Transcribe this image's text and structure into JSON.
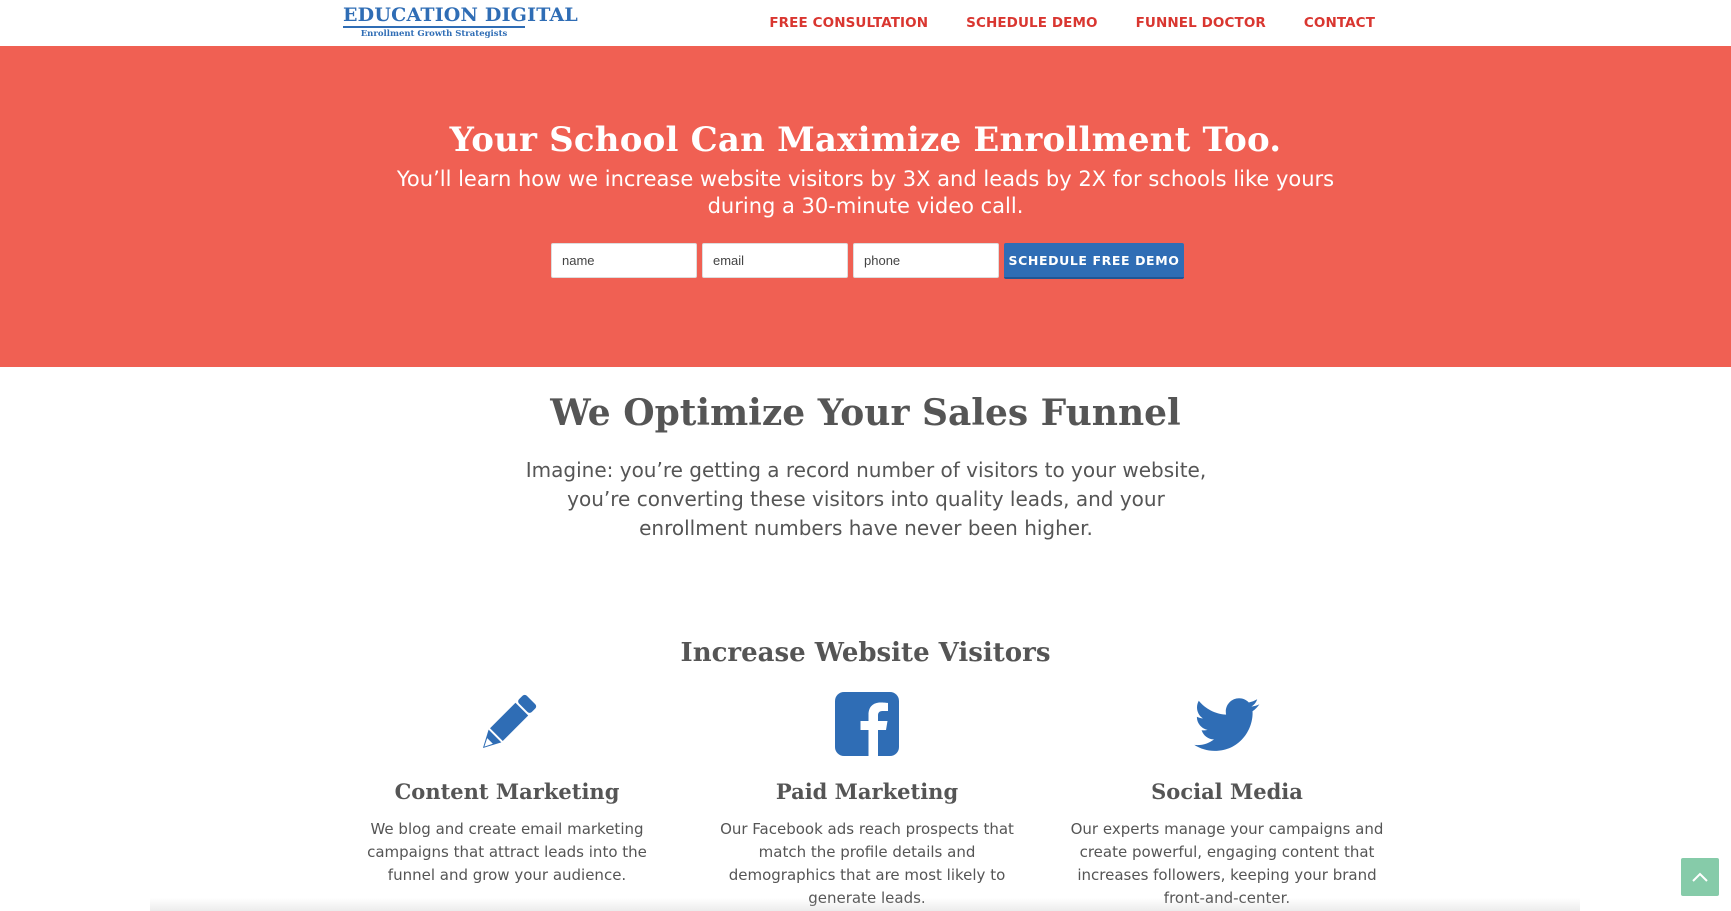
{
  "nav": {
    "logo_main": "EDUCATION DIGITAL",
    "logo_sub": "Enrollment Growth Strategists",
    "links": [
      "FREE CONSULTATION",
      "SCHEDULE DEMO",
      "FUNNEL DOCTOR",
      "CONTACT"
    ]
  },
  "hero": {
    "title": "Your School Can Maximize Enrollment Too.",
    "subtitle": "You’ll learn how we increase website visitors by 3X and leads by 2X for schools like yours during a 30-minute video call.",
    "name_placeholder": "name",
    "email_placeholder": "email",
    "phone_placeholder": "phone",
    "button_label": "SCHEDULE FREE DEMO"
  },
  "optimize": {
    "title": "We Optimize Your Sales Funnel",
    "text": "Imagine: you’re getting a record number of visitors to your website, you’re converting these visitors into quality leads, and your enrollment numbers have never been higher."
  },
  "visitors": {
    "title": "Increase Website Visitors",
    "features": [
      {
        "icon": "pencil-icon",
        "title": "Content Marketing",
        "text": "We blog and create email marketing campaigns that attract leads into the funnel and grow your audience."
      },
      {
        "icon": "facebook-icon",
        "title": "Paid Marketing",
        "text": "Our Facebook ads reach prospects that match the profile details and demographics that are most likely to generate leads."
      },
      {
        "icon": "twitter-icon",
        "title": "Social Media",
        "text": "Our experts manage your campaigns and create powerful, engaging content that increases followers, keeping your brand front-and-center."
      }
    ]
  },
  "colors": {
    "hero_bg": "#f06053",
    "brand_blue": "#2f6db5",
    "nav_red": "#d93630",
    "scroll_top_bg": "#86cba9"
  }
}
